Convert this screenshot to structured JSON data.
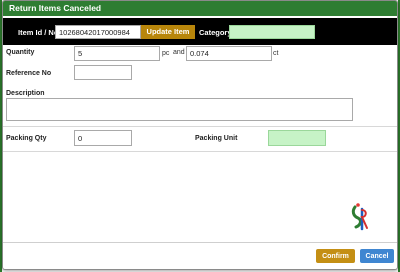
{
  "dialog": {
    "title": "Return Items Canceled"
  },
  "item_bar": {
    "item_label": "Item Id / No",
    "item_value": "10268042017000984",
    "update_button": "Update Item",
    "category_label": "Category",
    "category_value": ""
  },
  "form": {
    "quantity_label": "Quantity",
    "quantity_value": "5",
    "pc_unit": "pc",
    "and_label": "and",
    "carat_value": "0.074",
    "ct_unit": "ct",
    "reference_label": "Reference No",
    "reference_value": "",
    "description_label": "Description",
    "description_value": "",
    "packing_qty_label": "Packing Qty",
    "packing_qty_value": "0",
    "packing_unit_label": "Packing Unit",
    "packing_unit_value": ""
  },
  "footer": {
    "confirm": "Confirm",
    "cancel": "Cancel"
  },
  "colors": {
    "header": "#2e7d32",
    "item_bar": "#000000",
    "update_button": "#b8860b",
    "highlight_input": "#c6f3c6",
    "confirm_button": "#c48f14",
    "cancel_button": "#3f86d1"
  },
  "icons": {
    "logo": "brand-logo-icon"
  }
}
